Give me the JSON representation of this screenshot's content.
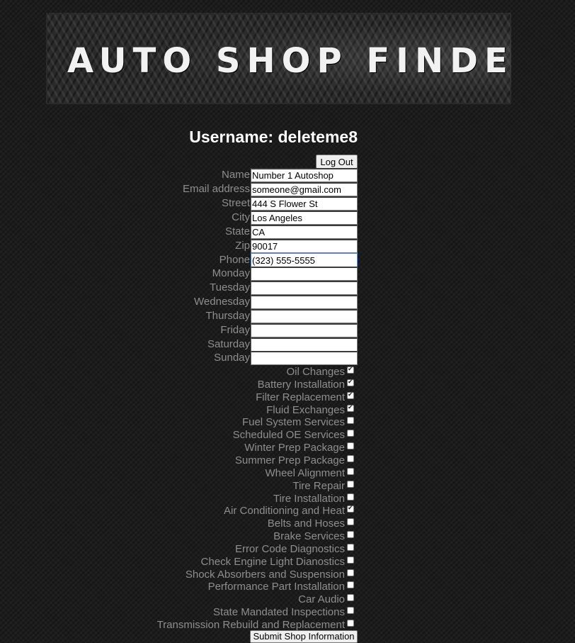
{
  "header": {
    "title": "AUTO SHOP FINDER"
  },
  "user": {
    "heading": "Username: deleteme8",
    "logout_label": "Log Out"
  },
  "fields": [
    {
      "label": "Name",
      "value": "Number 1 Autoshop"
    },
    {
      "label": "Email address",
      "value": "someone@gmail.com"
    },
    {
      "label": "Street",
      "value": "444 S Flower St"
    },
    {
      "label": "City",
      "value": "Los Angeles"
    },
    {
      "label": "State",
      "value": "CA"
    },
    {
      "label": "Zip",
      "value": "90017"
    },
    {
      "label": "Phone",
      "value": "(323) 555-5555",
      "focused": true
    },
    {
      "label": "Monday",
      "value": ""
    },
    {
      "label": "Tuesday",
      "value": ""
    },
    {
      "label": "Wednesday",
      "value": ""
    },
    {
      "label": "Thursday",
      "value": ""
    },
    {
      "label": "Friday",
      "value": ""
    },
    {
      "label": "Saturday",
      "value": ""
    },
    {
      "label": "Sunday",
      "value": ""
    }
  ],
  "services": [
    {
      "label": "Oil Changes",
      "checked": true
    },
    {
      "label": "Battery Installation",
      "checked": true
    },
    {
      "label": "Filter Replacement",
      "checked": true
    },
    {
      "label": "Fluid Exchanges",
      "checked": true
    },
    {
      "label": "Fuel System Services",
      "checked": false
    },
    {
      "label": "Scheduled OE Services",
      "checked": false
    },
    {
      "label": "Winter Prep Package",
      "checked": false
    },
    {
      "label": "Summer Prep Package",
      "checked": false
    },
    {
      "label": "Wheel Alignment",
      "checked": false
    },
    {
      "label": "Tire Repair",
      "checked": false
    },
    {
      "label": "Tire Installation",
      "checked": false
    },
    {
      "label": "Air Conditioning and Heat",
      "checked": true
    },
    {
      "label": "Belts and Hoses",
      "checked": false
    },
    {
      "label": "Brake Services",
      "checked": false
    },
    {
      "label": "Error Code Diagnostics",
      "checked": false
    },
    {
      "label": "Check Engine Light Dianostics",
      "checked": false
    },
    {
      "label": "Shock Absorbers and Suspension",
      "checked": false
    },
    {
      "label": "Performance Part Installation",
      "checked": false
    },
    {
      "label": "Car Audio",
      "checked": false
    },
    {
      "label": "State Mandated Inspections",
      "checked": false
    },
    {
      "label": "Transmission Rebuild and Replacement",
      "checked": false
    }
  ],
  "form": {
    "submit_label": "Submit Shop Information"
  }
}
